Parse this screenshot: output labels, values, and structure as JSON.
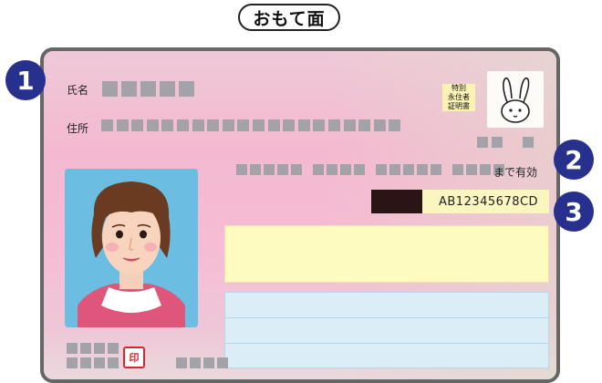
{
  "header": {
    "title": "おもて面"
  },
  "card": {
    "name_label": "氏名",
    "address_label": "住所",
    "permit_lines": [
      "特別",
      "永住者",
      "証明書"
    ],
    "expiry_suffix": "まで有効",
    "card_number": "AB12345678CD",
    "seal_text": "印"
  },
  "badges": [
    "1",
    "2",
    "3"
  ],
  "icons": {
    "rabbit": "rabbit-icon",
    "photo": "portrait-photo"
  },
  "colors": {
    "badge": "#27318d",
    "card_pink": "#f4b9d0",
    "yellow_field": "#fdfbbf",
    "blue_field": "#dbeef7",
    "redaction": "#a2a2a8",
    "seal_red": "#d8262d"
  }
}
